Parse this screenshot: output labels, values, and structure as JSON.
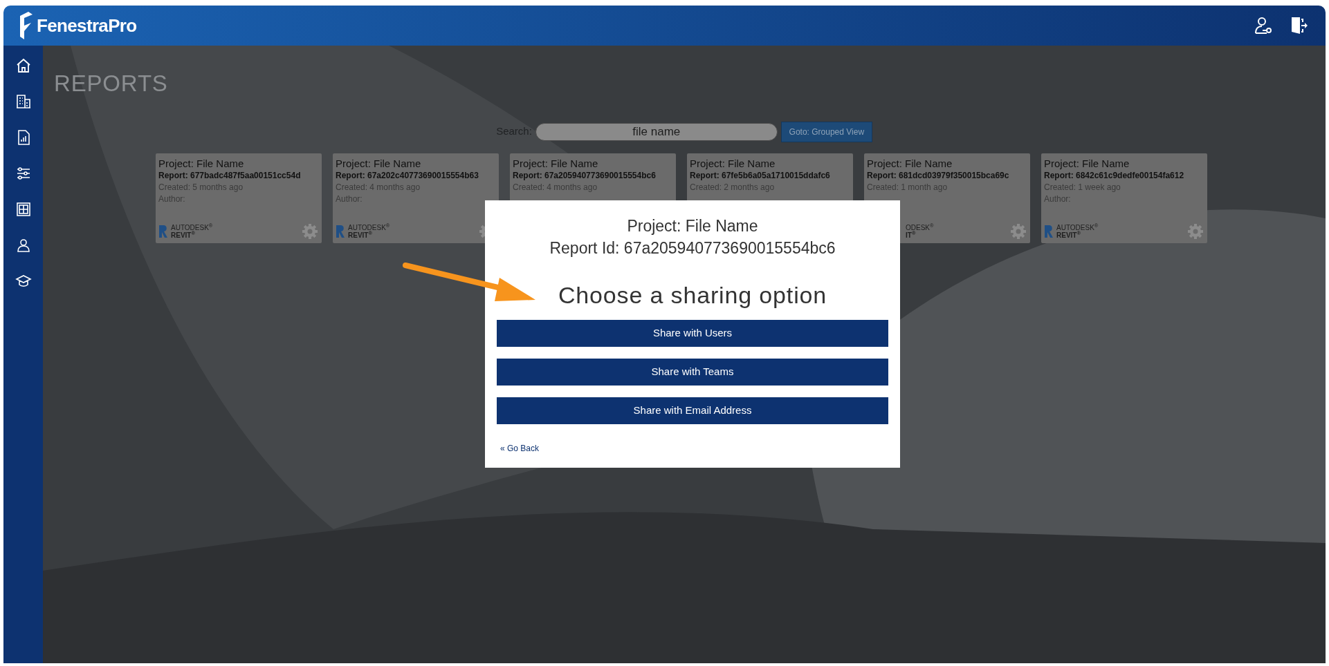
{
  "app": {
    "name": "FenestraPro"
  },
  "page": {
    "title": "REPORTS"
  },
  "search": {
    "label": "Search:",
    "value": "file name"
  },
  "grouped_view_button": "Goto: Grouped View",
  "cards": [
    {
      "project": "Project: File Name",
      "report": "Report: 677badc487f5aa00151cc54d",
      "created": "Created: 5 months ago",
      "author": "Author:",
      "logo": {
        "cut": false,
        "lines": [
          "AUTODESK$^{®}$",
          "REVIT$^{®}$"
        ]
      }
    },
    {
      "project": "Project: File Name",
      "report": "Report: 67a202c40773690015554b63",
      "created": "Created: 4 months ago",
      "author": "Author:",
      "logo": {
        "cut": false,
        "lines": [
          "AUTODESK$^{®}$",
          "REVIT$^{®}$"
        ]
      }
    },
    {
      "project": "Project: File Name",
      "report": "Report: 67a205940773690015554bc6",
      "created": "Created: 4 months ago"
    },
    {
      "project": "Project: File Name",
      "report": "Report: 67fe5b6a05a1710015ddafc6",
      "created": "Created: 2 months ago"
    },
    {
      "project": "Project: File Name",
      "report": "Report: 681dcd03979f350015bca69c",
      "created": "Created: 1 month ago",
      "logo": {
        "cut": true,
        "lines": [
          "ODESK$^{®}$",
          "IT$^{®}$"
        ]
      }
    },
    {
      "project": "Project: File Name",
      "report": "Report: 6842c61c9dedfe00154fa612",
      "created": "Created: 1 week ago",
      "author": "Author:",
      "logo": {
        "cut": false,
        "lines": [
          "AUTODESK$^{®}$",
          "REVIT$^{®}$"
        ]
      }
    }
  ],
  "dialog": {
    "project": "Project: File Name",
    "report_id": "Report Id: 67a205940773690015554bc6",
    "heading": "Choose a sharing option",
    "buttons": [
      "Share with Users",
      "Share with Teams",
      "Share with Email Address"
    ],
    "back_link": "« Go Back"
  }
}
